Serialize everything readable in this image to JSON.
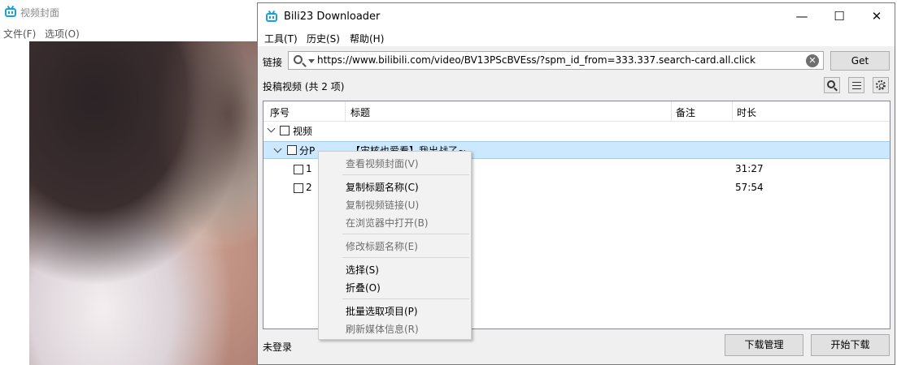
{
  "cover_window": {
    "title": "视频封面",
    "menu": [
      "文件(F)",
      "选项(O)"
    ]
  },
  "downloader": {
    "title": "Bili23 Downloader",
    "window_controls": {
      "minimize": "—",
      "maximize": "☐",
      "close": "✕"
    },
    "menu": [
      "工具(T)",
      "历史(S)",
      "帮助(H)"
    ],
    "link_label": "链接",
    "url_value": "https://www.bilibili.com/video/BV13PScBVEss/?spm_id_from=333.337.search-card.all.click",
    "get_button": "Get",
    "list_summary": "投稿视频 (共 2 项)",
    "columns": [
      "序号",
      "标题",
      "备注",
      "时长"
    ],
    "tree": {
      "root_label": "视频",
      "part_label": "分P",
      "part_title": "【宙核也爱看】我出战了~",
      "items": [
        {
          "index": "1",
          "duration": "31:27"
        },
        {
          "index": "2",
          "duration": "57:54"
        }
      ]
    },
    "status": "未登录",
    "download_manager_button": "下载管理",
    "start_download_button": "开始下载"
  },
  "context_menu": {
    "items": [
      {
        "label": "查看视频封面(V)",
        "enabled": false
      },
      {
        "label": "复制标题名称(C)",
        "enabled": true
      },
      {
        "label": "复制视频链接(U)",
        "enabled": false
      },
      {
        "label": "在浏览器中打开(B)",
        "enabled": false
      },
      {
        "label": "修改标题名称(E)",
        "enabled": false
      },
      {
        "label": "选择(S)",
        "enabled": true
      },
      {
        "label": "折叠(O)",
        "enabled": true
      },
      {
        "label": "批量选取项目(P)",
        "enabled": true
      },
      {
        "label": "刷新媒体信息(R)",
        "enabled": false
      }
    ]
  },
  "colors": {
    "selection": "#cce8ff",
    "accent": "#1aa0d8"
  }
}
